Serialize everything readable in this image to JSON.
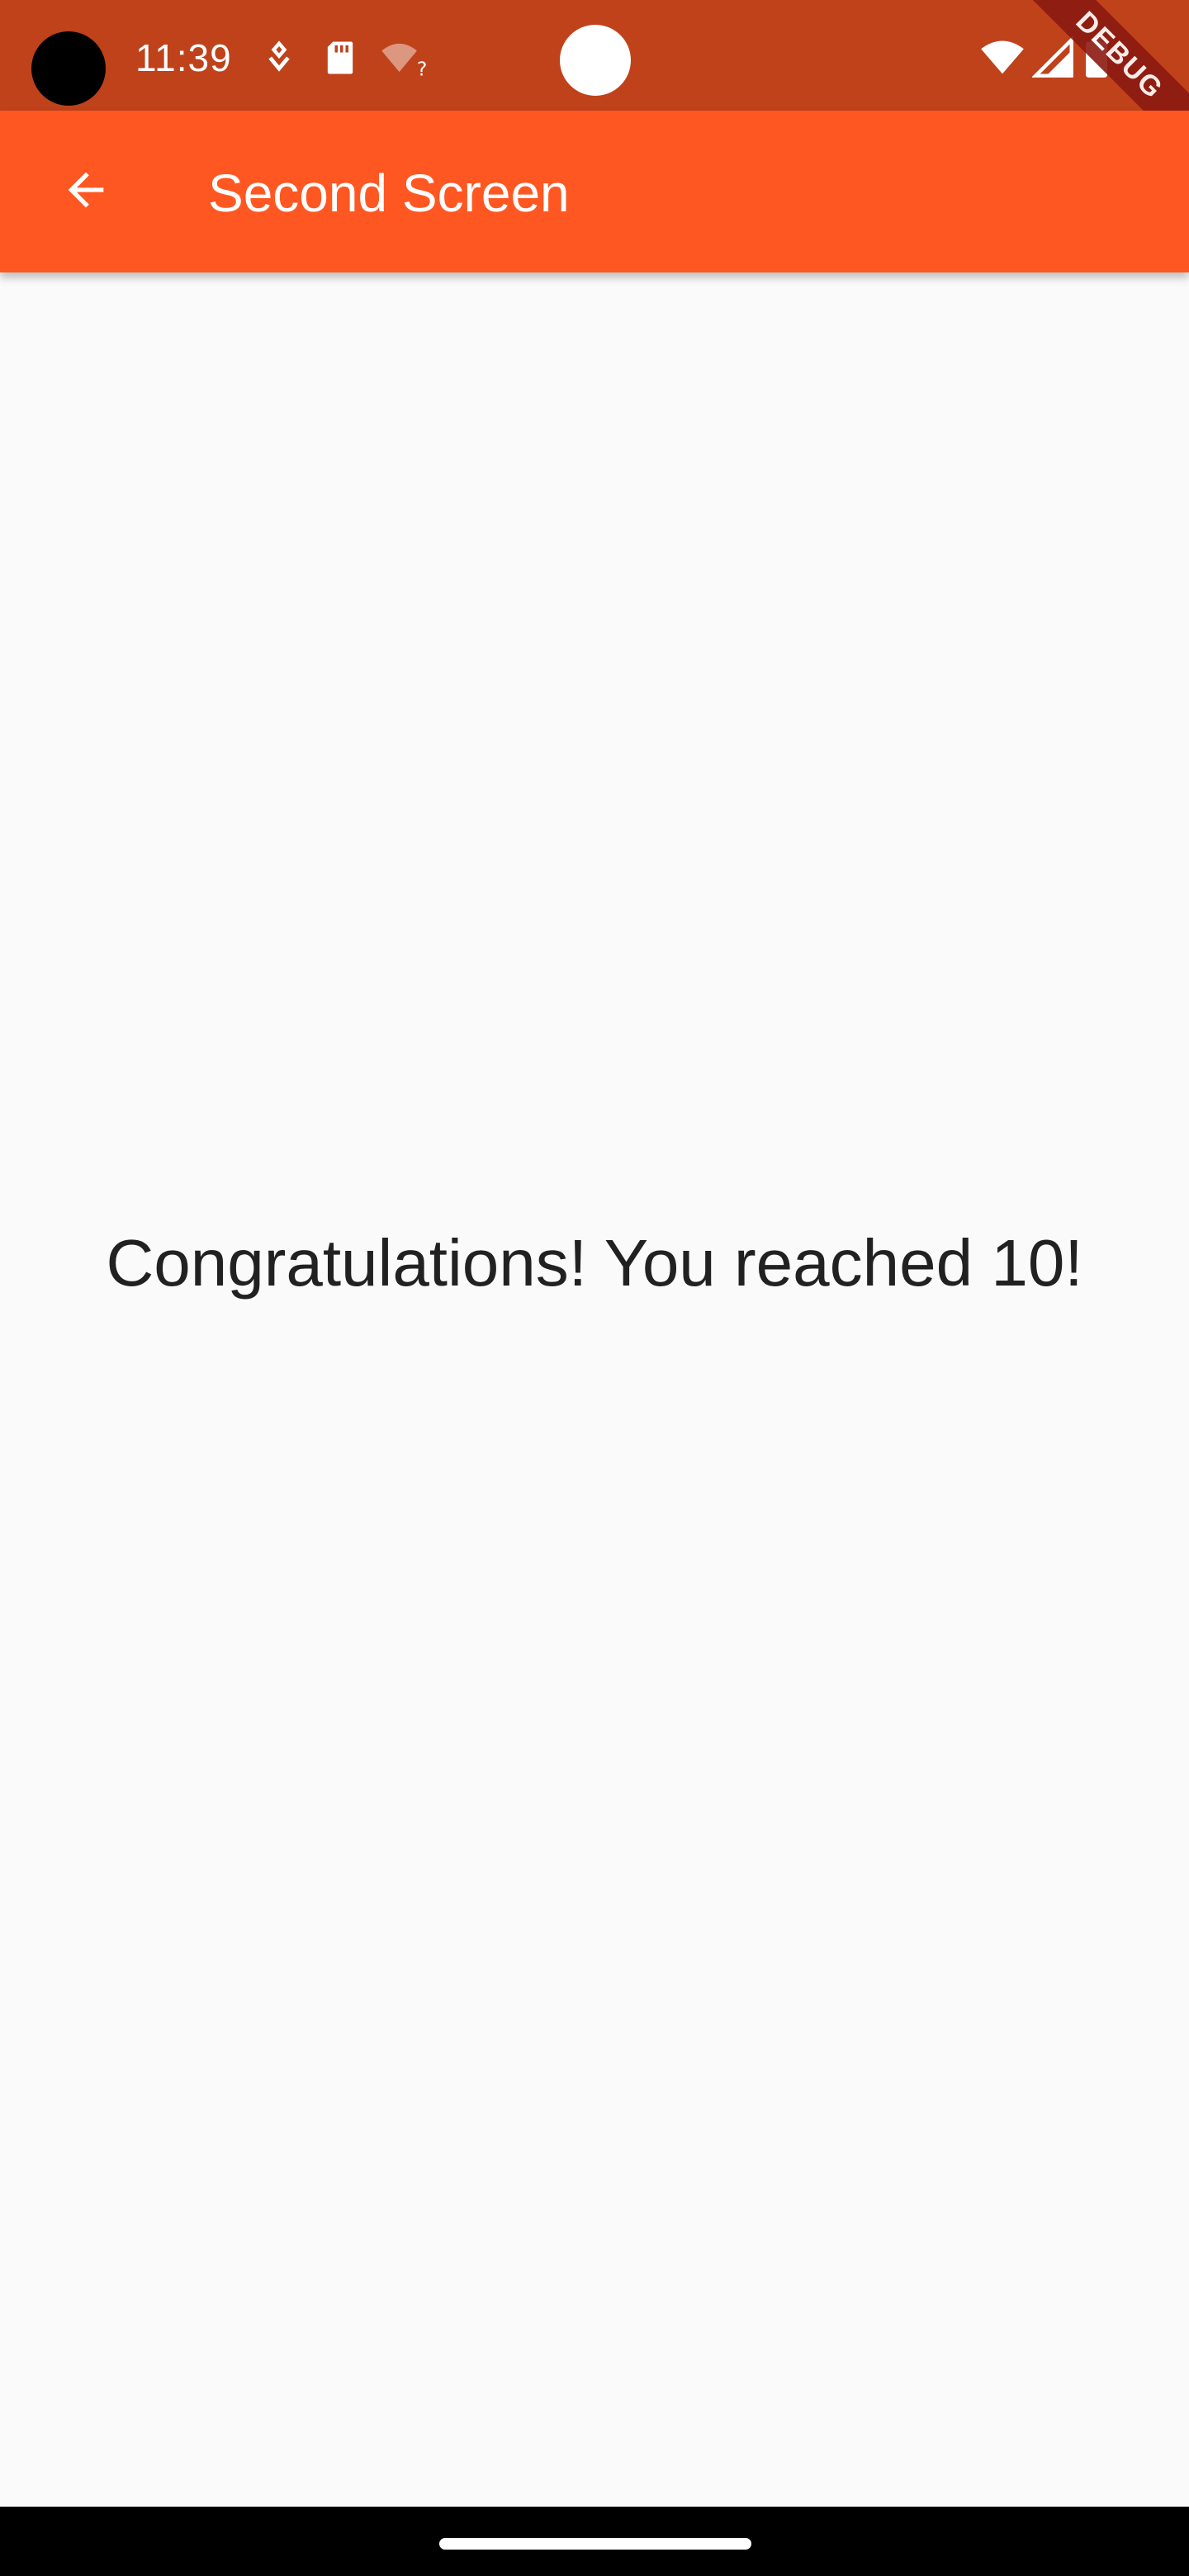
{
  "status_bar": {
    "time": "11:39",
    "background_color": "#bf421b",
    "left_icons": [
      "data-saver-icon",
      "sd-card-icon",
      "wifi-unknown-icon"
    ],
    "right_icons": [
      "wifi-icon",
      "cell-signal-icon",
      "battery-icon"
    ]
  },
  "debug_banner": {
    "label": "DEBUG"
  },
  "app_bar": {
    "title": "Second Screen",
    "back_icon": "arrow-back-icon",
    "background_color": "#ff5722"
  },
  "main": {
    "message": "Congratulations! You reached 10!",
    "background_color": "#fafafa"
  },
  "nav_bar": {
    "home_indicator": "home-pill"
  }
}
